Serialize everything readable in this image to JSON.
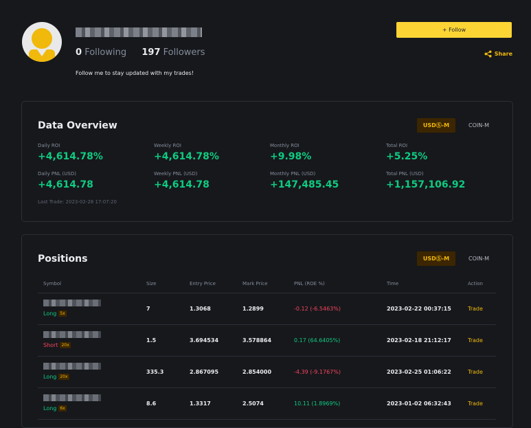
{
  "profile": {
    "following_count": "0",
    "following_label": "Following",
    "followers_count": "197",
    "followers_label": "Followers",
    "bio": "Follow me to stay updated with my trades!",
    "follow_button": "+ Follow",
    "share_label": "Share"
  },
  "overview": {
    "title": "Data Overview",
    "tabs": [
      "USDⓈ-M",
      "COIN-M"
    ],
    "metrics": [
      {
        "label": "Daily ROI",
        "value": "+4,614.78%"
      },
      {
        "label": "Weekly ROI",
        "value": "+4,614.78%"
      },
      {
        "label": "Monthly ROI",
        "value": "+9.98%"
      },
      {
        "label": "Total ROI",
        "value": "+5.25%"
      },
      {
        "label": "Daily PNL (USD)",
        "value": "+4,614.78"
      },
      {
        "label": "Weekly PNL (USD)",
        "value": "+4,614.78"
      },
      {
        "label": "Monthly PNL (USD)",
        "value": "+147,485.45"
      },
      {
        "label": "Total PNL (USD)",
        "value": "+1,157,106.92"
      }
    ],
    "last_trade": "Last Trade: 2023-02-28 17:07:20"
  },
  "positions": {
    "title": "Positions",
    "tabs": [
      "USDⓈ-M",
      "COIN-M"
    ],
    "columns": [
      "Symbol",
      "Size",
      "Entry Price",
      "Mark Price",
      "PNL (ROE %)",
      "Time",
      "Action"
    ],
    "rows": [
      {
        "side": "Long",
        "leverage": "5x",
        "size": "7",
        "entry": "1.3068",
        "mark": "1.2899",
        "pnl": "-0.12 (-6.5463%)",
        "time": "2023-02-22 00:37:15",
        "action": "Trade"
      },
      {
        "side": "Short",
        "leverage": "20x",
        "size": "1.5",
        "entry": "3.694534",
        "mark": "3.578864",
        "pnl": "0.17 (64.6405%)",
        "time": "2023-02-18 21:12:17",
        "action": "Trade"
      },
      {
        "side": "Long",
        "leverage": "20x",
        "size": "335.3",
        "entry": "2.867095",
        "mark": "2.854000",
        "pnl": "-4.39 (-9.1767%)",
        "time": "2023-02-25 01:06:22",
        "action": "Trade"
      },
      {
        "side": "Long",
        "leverage": "6x",
        "size": "8.6",
        "entry": "1.3317",
        "mark": "2.5074",
        "pnl": "10.11 (1.8969%)",
        "time": "2023-01-02 06:32:43",
        "action": "Trade"
      }
    ]
  },
  "colors": {
    "accent": "#fcd535",
    "positive": "#0ecb81",
    "negative": "#f6465d",
    "background": "#17181c"
  }
}
